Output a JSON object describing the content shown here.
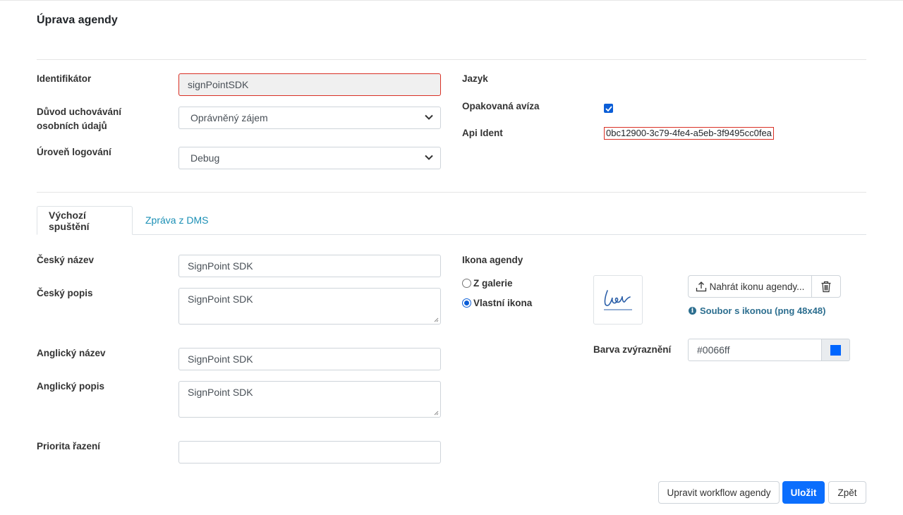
{
  "page": {
    "title": "Úprava agendy"
  },
  "general": {
    "identifier_label": "Identifikátor",
    "identifier_value": "signPointSDK",
    "retention_label": "Důvod uchovávání osobních údajů",
    "retention_value": "Oprávněný zájem",
    "logging_label": "Úroveň logování",
    "logging_value": "Debug",
    "language_label": "Jazyk",
    "repeat_label": "Opakovaná avíza",
    "repeat_checked": true,
    "api_label": "Api Ident",
    "api_value": "0bc12900-3c79-4fe4-a5eb-3f9495cc0fea"
  },
  "tabs": [
    {
      "label": "Výchozí spuštění",
      "active": true
    },
    {
      "label": "Zpráva z DMS",
      "active": false
    }
  ],
  "form": {
    "cz_name_label": "Český název",
    "cz_name_value": "SignPoint SDK",
    "cz_desc_label": "Český popis",
    "cz_desc_value": "SignPoint SDK",
    "en_name_label": "Anglický název",
    "en_name_value": "SignPoint SDK",
    "en_desc_label": "Anglický popis",
    "en_desc_value": "SignPoint SDK",
    "priority_label": "Priorita řazení",
    "priority_value": ""
  },
  "icon": {
    "section_label": "Ikona agendy",
    "option_gallery": "Z galerie",
    "option_custom": "Vlastní ikona",
    "selected": "custom",
    "upload_label": "Nahrát ikonu agendy...",
    "info_text": "Soubor s ikonou (png 48x48)",
    "color_label": "Barva zvýraznění",
    "color_value": "#0066ff"
  },
  "buttons": {
    "workflow": "Upravit workflow agendy",
    "save": "Uložit",
    "back": "Zpět"
  },
  "colors": {
    "accent": "#0066ff",
    "link": "#1a8fb5",
    "primary_button": "#0b6efd",
    "error_border": "#d93025"
  }
}
